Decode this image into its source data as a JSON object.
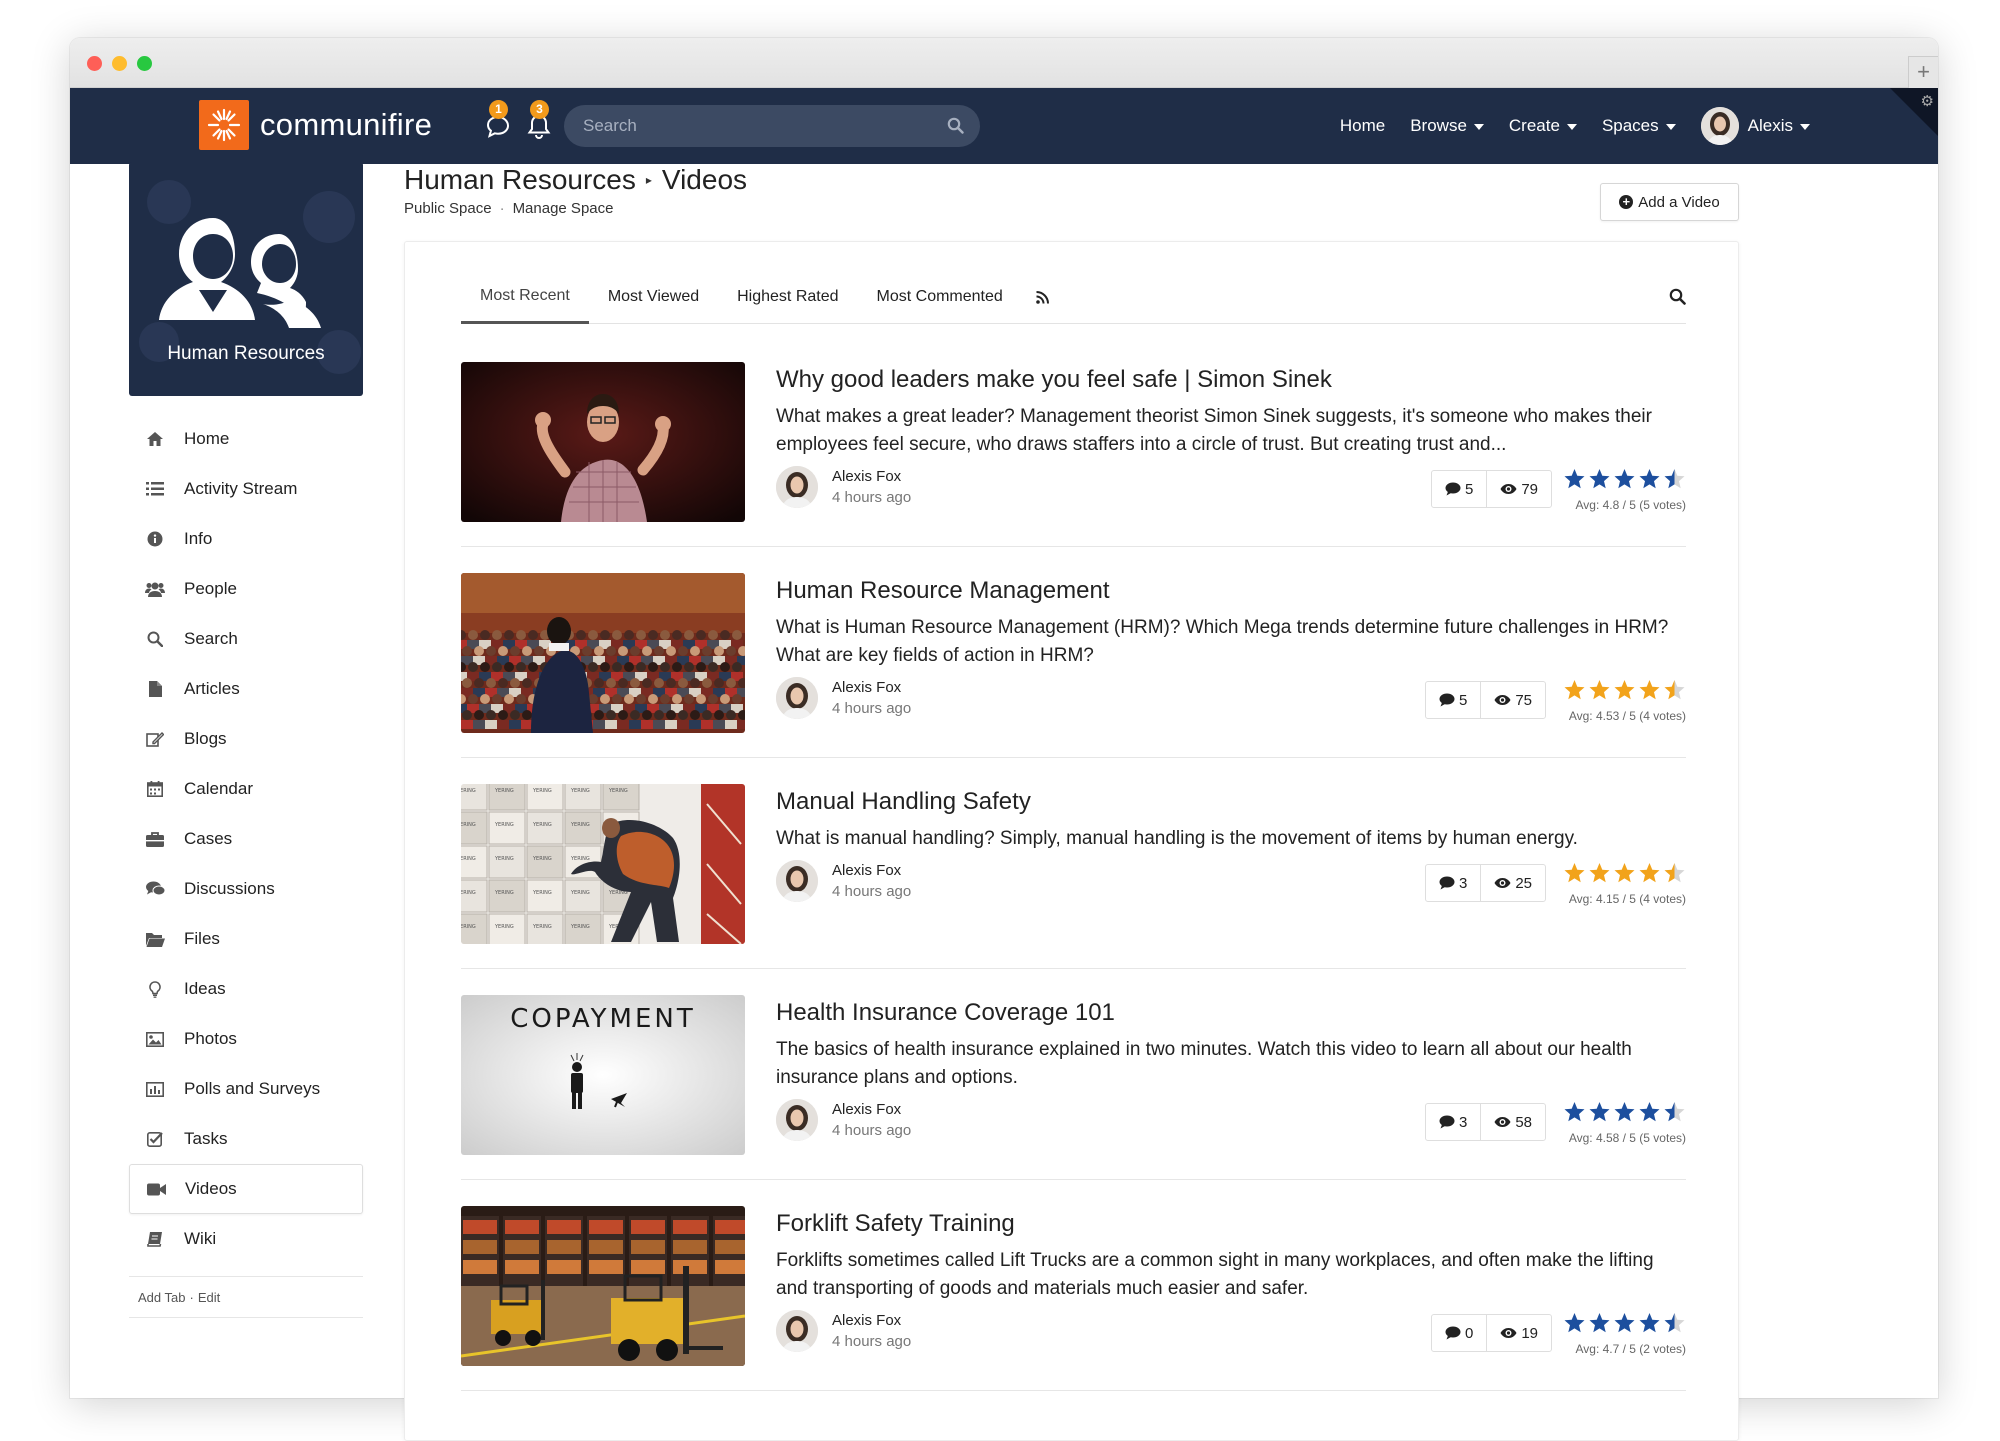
{
  "brand": {
    "name": "communifire"
  },
  "nav": {
    "messages_count": "1",
    "notifications_count": "3",
    "search_placeholder": "Search",
    "links": [
      "Home",
      "Browse",
      "Create",
      "Spaces"
    ],
    "user_name": "Alexis"
  },
  "space": {
    "name": "Human Resources"
  },
  "sidebar": {
    "items": [
      {
        "label": "Home",
        "icon": "home-icon"
      },
      {
        "label": "Activity Stream",
        "icon": "list-icon"
      },
      {
        "label": "Info",
        "icon": "info-icon"
      },
      {
        "label": "People",
        "icon": "people-icon"
      },
      {
        "label": "Search",
        "icon": "search-icon"
      },
      {
        "label": "Articles",
        "icon": "file-icon"
      },
      {
        "label": "Blogs",
        "icon": "blog-icon"
      },
      {
        "label": "Calendar",
        "icon": "calendar-icon"
      },
      {
        "label": "Cases",
        "icon": "briefcase-icon"
      },
      {
        "label": "Discussions",
        "icon": "comments-icon"
      },
      {
        "label": "Files",
        "icon": "folder-icon"
      },
      {
        "label": "Ideas",
        "icon": "lightbulb-icon"
      },
      {
        "label": "Photos",
        "icon": "image-icon"
      },
      {
        "label": "Polls and Surveys",
        "icon": "bar-chart-icon"
      },
      {
        "label": "Tasks",
        "icon": "checkbox-icon"
      },
      {
        "label": "Videos",
        "icon": "video-camera-icon"
      },
      {
        "label": "Wiki",
        "icon": "book-icon"
      }
    ],
    "active": "Videos",
    "footer_add": "Add Tab",
    "footer_edit": "Edit"
  },
  "header": {
    "crumb_space": "Human Resources",
    "crumb_page": "Videos",
    "public_space": "Public Space",
    "manage_space": "Manage Space",
    "add_button": "Add a Video"
  },
  "tabs": [
    "Most Recent",
    "Most Viewed",
    "Highest Rated",
    "Most Commented"
  ],
  "active_tab": "Most Recent",
  "colors": {
    "navbar": "#1f2d47",
    "brand_orange": "#f26a1b",
    "badge": "#f29a1b",
    "star_blue": "#1d4f9e",
    "star_gold": "#f2a31b"
  },
  "videos": [
    {
      "title": "Why good leaders make you feel safe | Simon Sinek",
      "description": "What makes a great leader? Management theorist Simon Sinek suggests, it's someone who makes their employees feel secure, who draws staffers into a circle of trust. But creating trust and...",
      "author": "Alexis Fox",
      "time": "4 hours ago",
      "comments": "5",
      "views": "79",
      "rating": 4.8,
      "star_color": "blue",
      "rating_text": "Avg: 4.8 / 5 (5 votes)",
      "thumb": "speaker"
    },
    {
      "title": "Human Resource Management",
      "description": "What is Human Resource Management (HRM)? Which Mega trends determine future challenges in HRM? What are key fields of action in HRM?",
      "author": "Alexis Fox",
      "time": "4 hours ago",
      "comments": "5",
      "views": "75",
      "rating": 4.53,
      "star_color": "gold",
      "rating_text": "Avg: 4.53 / 5 (4 votes)",
      "thumb": "audience"
    },
    {
      "title": "Manual Handling Safety",
      "description": "What is manual handling? Simply, manual handling is the movement of items by human energy.",
      "author": "Alexis Fox",
      "time": "4 hours ago",
      "comments": "3",
      "views": "25",
      "rating": 4.15,
      "star_color": "gold",
      "rating_text": "Avg: 4.15 / 5 (4 votes)",
      "thumb": "boxes"
    },
    {
      "title": "Health Insurance Coverage 101",
      "description": "The basics of health insurance explained in two minutes. Watch this video to learn all about our health insurance plans and options.",
      "author": "Alexis Fox",
      "time": "4 hours ago",
      "comments": "3",
      "views": "58",
      "rating": 4.58,
      "star_color": "blue",
      "rating_text": "Avg: 4.58 / 5 (5 votes)",
      "thumb": "copayment",
      "thumb_text": "COPAYMENT"
    },
    {
      "title": "Forklift Safety Training",
      "description": "Forklifts sometimes called Lift Trucks are a common sight in many workplaces, and often make the lifting and transporting of goods and materials much easier and safer.",
      "author": "Alexis Fox",
      "time": "4 hours ago",
      "comments": "0",
      "views": "19",
      "rating": 4.7,
      "star_color": "blue",
      "rating_text": "Avg: 4.7 / 5 (2 votes)",
      "thumb": "forklift"
    }
  ]
}
